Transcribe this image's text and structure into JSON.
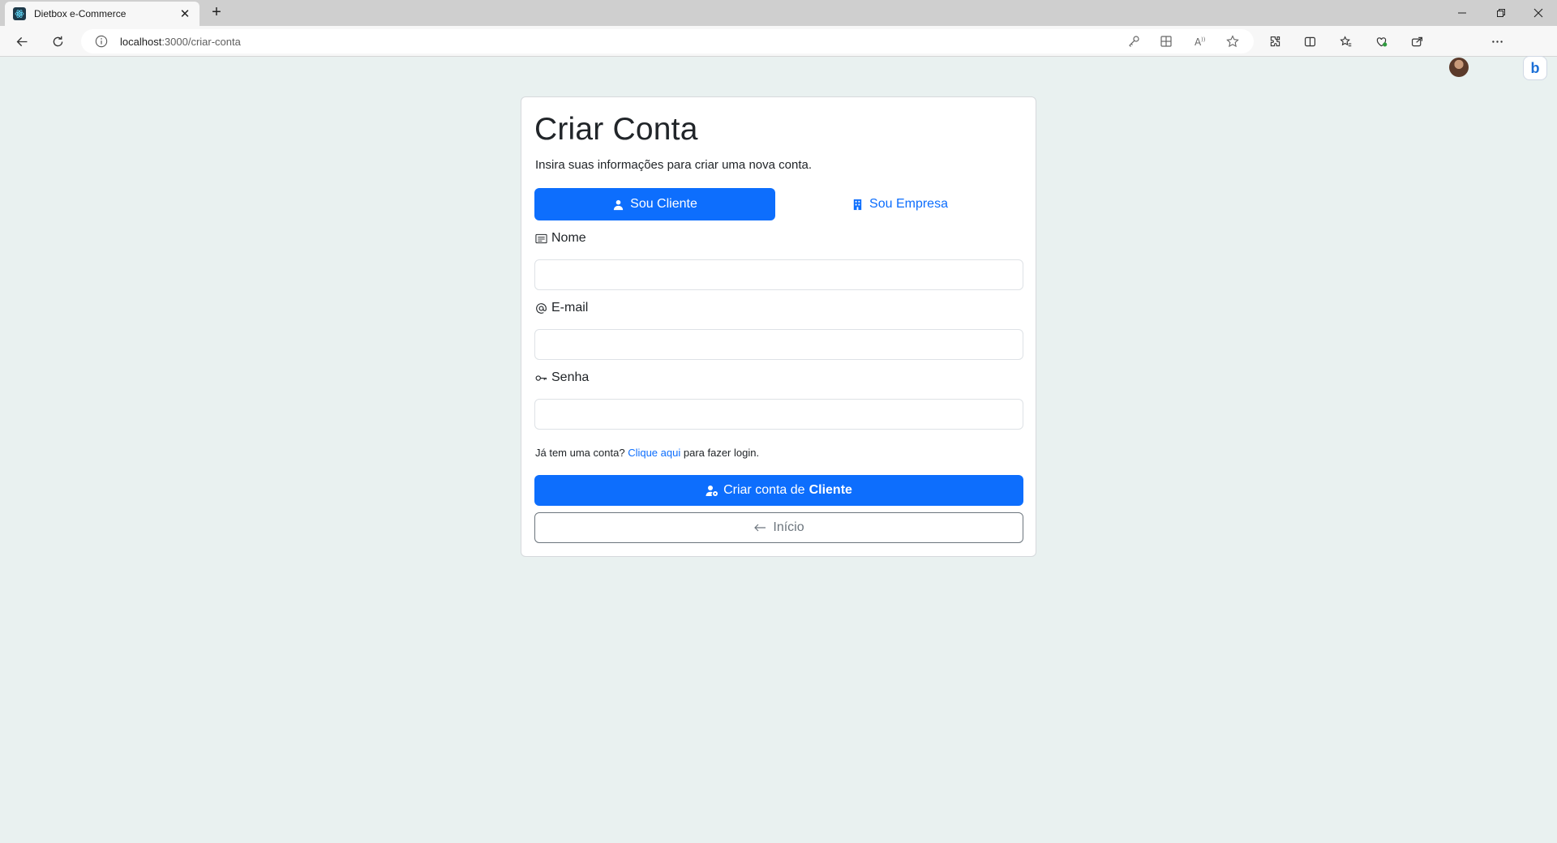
{
  "browser": {
    "tab_title": "Dietbox e-Commerce",
    "tab_close": "✕",
    "new_tab": "+",
    "url_host": "localhost",
    "url_path": ":3000/criar-conta"
  },
  "page": {
    "title": "Criar Conta",
    "subtitle": "Insira suas informações para criar uma nova conta.",
    "tabs": [
      {
        "label": "Sou Cliente",
        "active": true
      },
      {
        "label": "Sou Empresa",
        "active": false
      }
    ],
    "fields": {
      "name_label": "Nome",
      "email_label": "E-mail",
      "password_label": "Senha",
      "name_value": "",
      "email_value": "",
      "password_value": ""
    },
    "login_hint_prefix": "Já tem uma conta?",
    "login_link": "Clique aqui",
    "login_hint_suffix": "para fazer login.",
    "submit_prefix": "Criar conta de",
    "submit_bold": "Cliente",
    "home_label": "Início"
  },
  "colors": {
    "primary": "#0d6efd",
    "page_bg": "#e9f1f0",
    "outline": "#6c757d"
  }
}
